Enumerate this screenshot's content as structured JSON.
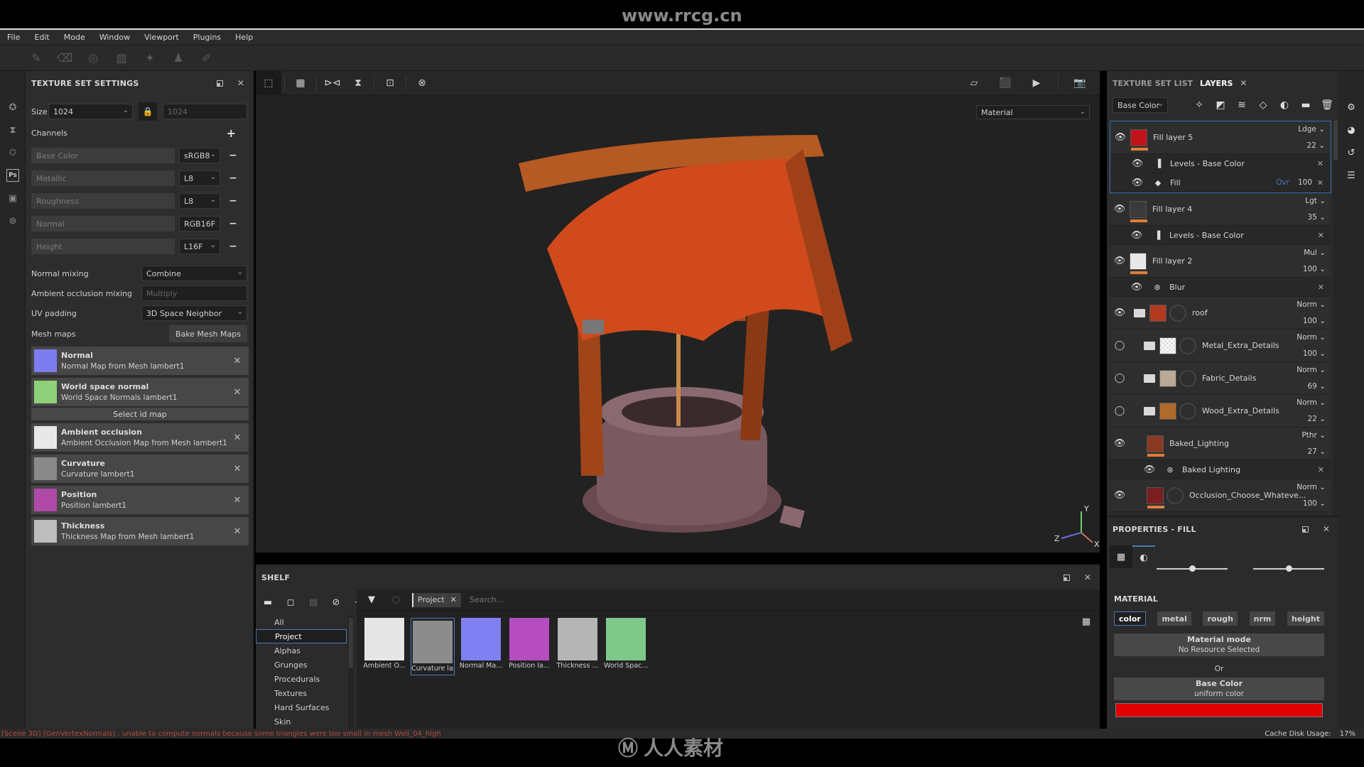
{
  "watermark": {
    "url": "www.rrcg.cn",
    "bottom_text": "人人素材"
  },
  "menu": [
    "File",
    "Edit",
    "Mode",
    "Window",
    "Viewport",
    "Plugins",
    "Help"
  ],
  "tools": [
    "paint-brush",
    "eraser",
    "projection",
    "polygon-fill",
    "smudge",
    "clone-stamp",
    "color-picker"
  ],
  "texture_set_settings": {
    "title": "TEXTURE SET SETTINGS",
    "size_label": "Size",
    "size_value": "1024",
    "size_locked_value": "1024",
    "channels_label": "Channels",
    "channels": [
      {
        "name": "Base Color",
        "format": "sRGB8"
      },
      {
        "name": "Metallic",
        "format": "L8"
      },
      {
        "name": "Roughness",
        "format": "L8"
      },
      {
        "name": "Normal",
        "format": "RGB16F"
      },
      {
        "name": "Height",
        "format": "L16F"
      }
    ],
    "normal_mixing_label": "Normal mixing",
    "normal_mixing_value": "Combine",
    "ao_mixing_label": "Ambient occlusion mixing",
    "ao_mixing_value": "Multiply",
    "uv_padding_label": "UV padding",
    "uv_padding_value": "3D Space Neighbor",
    "mesh_maps_label": "Mesh maps",
    "bake_button": "Bake Mesh Maps",
    "select_id_map": "Select id map",
    "mesh_maps": [
      {
        "title": "Normal",
        "subtitle": "Normal Map from Mesh lambert1",
        "thumb": "#7d7cf0"
      },
      {
        "title": "World space normal",
        "subtitle": "World Space Normals lambert1",
        "thumb": "#8fd07a"
      },
      {
        "title": "Ambient occlusion",
        "subtitle": "Ambient Occlusion Map from Mesh lambert1",
        "thumb": "#e8e8e8"
      },
      {
        "title": "Curvature",
        "subtitle": "Curvature lambert1",
        "thumb": "#8a8a8a"
      },
      {
        "title": "Position",
        "subtitle": "Position lambert1",
        "thumb": "#b04aa8"
      },
      {
        "title": "Thickness",
        "subtitle": "Thickness Map from Mesh lambert1",
        "thumb": "#bdbdbd"
      }
    ]
  },
  "viewport": {
    "display_mode": "Material",
    "axis": {
      "x": "X",
      "y": "Y",
      "z": "Z"
    }
  },
  "shelf": {
    "title": "SHELF",
    "categories": [
      "All",
      "Project",
      "Alphas",
      "Grunges",
      "Procedurals",
      "Textures",
      "Hard Surfaces",
      "Skin"
    ],
    "active_category": "Project",
    "filter_chip": "Project",
    "search_placeholder": "Search...",
    "assets": [
      {
        "name": "Ambient O...",
        "color": "#e6e6e6"
      },
      {
        "name": "Curvature la...",
        "color": "#8c8c8c",
        "selected": true
      },
      {
        "name": "Normal Ma...",
        "color": "#8080f2"
      },
      {
        "name": "Position la...",
        "color": "#b54dc0"
      },
      {
        "name": "Thickness ...",
        "color": "#b5b5b5"
      },
      {
        "name": "World Spac...",
        "color": "#7ec98a"
      }
    ]
  },
  "layers_panel": {
    "tab_texture_set_list": "TEXTURE SET LIST",
    "tab_layers": "LAYERS",
    "channel_select": "Base Color",
    "layers": [
      {
        "type": "layer",
        "name": "Fill layer 5",
        "blend": "Ldge",
        "opacity": "22",
        "thumb": "#c0141a",
        "visible": true,
        "selected": true
      },
      {
        "type": "effect",
        "name": "Levels - Base Color",
        "icon": "levels",
        "selected": true
      },
      {
        "type": "effect",
        "name": "Fill",
        "icon": "fill",
        "blend": "Ovr",
        "opacity": "100",
        "selected": true
      },
      {
        "type": "layer",
        "name": "Fill layer 4",
        "blend": "Lgt",
        "opacity": "35",
        "thumb": "#3a3a3a",
        "visible": true
      },
      {
        "type": "effect",
        "name": "Levels - Base Color",
        "icon": "levels"
      },
      {
        "type": "layer",
        "name": "Fill layer 2",
        "blend": "Mul",
        "opacity": "100",
        "thumb": "#e8e8e8",
        "visible": true
      },
      {
        "type": "effect",
        "name": "Blur",
        "icon": "substance"
      },
      {
        "type": "folder",
        "name": "roof",
        "blend": "Norm",
        "opacity": "100",
        "thumb": "#b23a1e",
        "visible": true
      },
      {
        "type": "folder",
        "name": "Metal_Extra_Details",
        "blend": "Norm",
        "opacity": "100",
        "thumb": "checker",
        "visible": false,
        "indent": true
      },
      {
        "type": "folder",
        "name": "Fabric_Details",
        "blend": "Norm",
        "opacity": "69",
        "thumb": "#b9a995",
        "visible": false,
        "indent": true
      },
      {
        "type": "folder",
        "name": "Wood_Extra_Details",
        "blend": "Norm",
        "opacity": "22",
        "thumb": "#b06a2a",
        "visible": false,
        "indent": true
      },
      {
        "type": "layer",
        "name": "Baked_Lighting",
        "blend": "Pthr",
        "opacity": "27",
        "thumb": "#8a3a22",
        "visible": true,
        "indent": true
      },
      {
        "type": "effect",
        "name": "Baked Lighting",
        "icon": "substance",
        "indent": true
      },
      {
        "type": "layer",
        "name": "Occlusion_Choose_Whateve...",
        "blend": "Norm",
        "opacity": "100",
        "thumb": "#7a1e22",
        "visible": true,
        "indent": true,
        "mask": true
      }
    ]
  },
  "properties": {
    "title": "PROPERTIES - FILL",
    "section": "MATERIAL",
    "channel_buttons": [
      "color",
      "metal",
      "rough",
      "nrm",
      "height"
    ],
    "active_channel": "color",
    "material_mode_title": "Material mode",
    "material_mode_value": "No Resource Selected",
    "or_label": "Or",
    "base_color_title": "Base Color",
    "base_color_value": "uniform color",
    "base_color_hex": "#e00000",
    "slider1": 0.5,
    "slider2": 0.5
  },
  "status": {
    "message": "[Scene 3D] [GenVertexNormals] : unable to compute normals because some triangles were too small in mesh Well_04_high",
    "cache_label": "Cache Disk Usage:",
    "cache_value": "17%"
  }
}
